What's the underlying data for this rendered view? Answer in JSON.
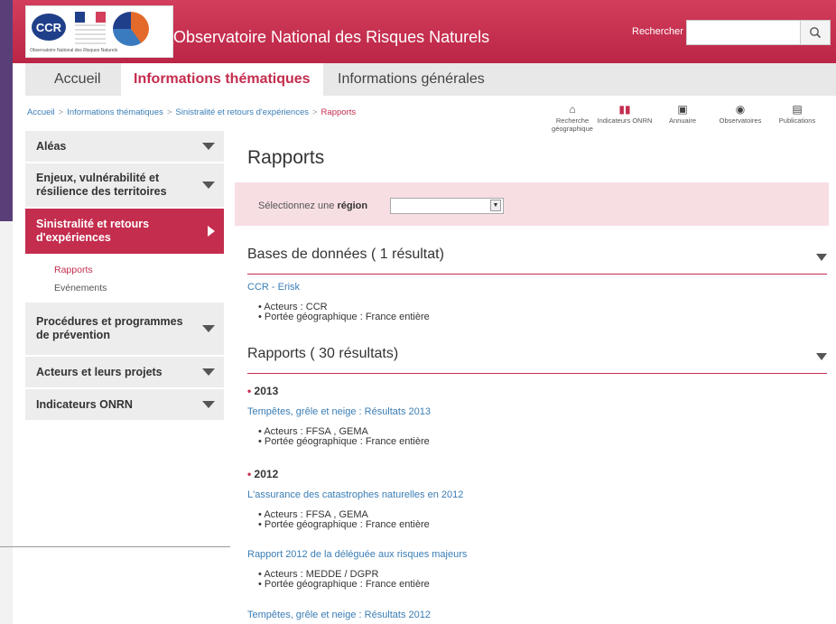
{
  "header": {
    "logo_text": "CCR",
    "logo_caption": "Observatoire National des Risques Naturels",
    "site_title": "Observatoire National des Risques Naturels",
    "search_label": "Rechercher",
    "search_placeholder": "",
    "search_icon": "magnifier-icon"
  },
  "nav": {
    "tabs": [
      {
        "label": "Accueil"
      },
      {
        "label": "Informations thématiques",
        "active": true
      },
      {
        "label": "Informations générales"
      }
    ]
  },
  "breadcrumb": {
    "items": [
      "Accueil",
      "Informations thématiques",
      "Sinistralité et retours d'expériences",
      "Rapports"
    ],
    "separator": ">"
  },
  "toolbar": [
    {
      "label": "Recherche géographique",
      "icon": "home-map-icon"
    },
    {
      "label": "Indicateurs ONRN",
      "icon": "bar-chart-icon"
    },
    {
      "label": "Annuaire",
      "icon": "contact-book-icon"
    },
    {
      "label": "Observatoires",
      "icon": "eye-icon"
    },
    {
      "label": "Publications",
      "icon": "publications-icon"
    }
  ],
  "sidebar": {
    "items": [
      {
        "label": "Aléas"
      },
      {
        "label": "Enjeux, vulnérabilité et résilience des territoires"
      },
      {
        "label": "Sinistralité et retours d'expériences",
        "active": true
      },
      {
        "label": "Procédures et programmes de prévention"
      },
      {
        "label": "Acteurs et leurs projets"
      },
      {
        "label": "Indicateurs ONRN"
      }
    ],
    "sub_items": [
      {
        "label": "Rapports",
        "active": true
      },
      {
        "label": "Evénements"
      }
    ]
  },
  "main": {
    "title": "Rapports",
    "region_label_prefix": "Sélectionnez une ",
    "region_label_bold": "région",
    "region_value": "",
    "databases": {
      "heading": "Bases de données ( 1 résultat)",
      "entries": [
        {
          "title": "CCR - Erisk",
          "acteurs": "Acteurs :  CCR",
          "portee": "Portée géographique :  France entière"
        }
      ]
    },
    "reports": {
      "heading": "Rapports ( 30 résultats)",
      "years": [
        {
          "year": "2013",
          "entries": [
            {
              "title": "Tempêtes, grêle et neige : Résultats 2013",
              "acteurs": "Acteurs :  FFSA ,  GEMA",
              "portee": "Portée géographique :  France entière"
            }
          ]
        },
        {
          "year": "2012",
          "entries": [
            {
              "title": "L'assurance des catastrophes naturelles en 2012",
              "acteurs": "Acteurs :  FFSA ,  GEMA",
              "portee": "Portée géographique :  France entière"
            },
            {
              "title": "Rapport 2012 de la déléguée aux risques majeurs",
              "acteurs": "Acteurs :  MEDDE / DGPR",
              "portee": "Portée géographique :  France entière"
            },
            {
              "title": "Tempêtes, grêle et neige : Résultats 2012"
            }
          ]
        }
      ]
    }
  },
  "colors": {
    "brand": "#c42d4e",
    "link": "#3a7db5",
    "region_bg": "#f7dee3"
  }
}
